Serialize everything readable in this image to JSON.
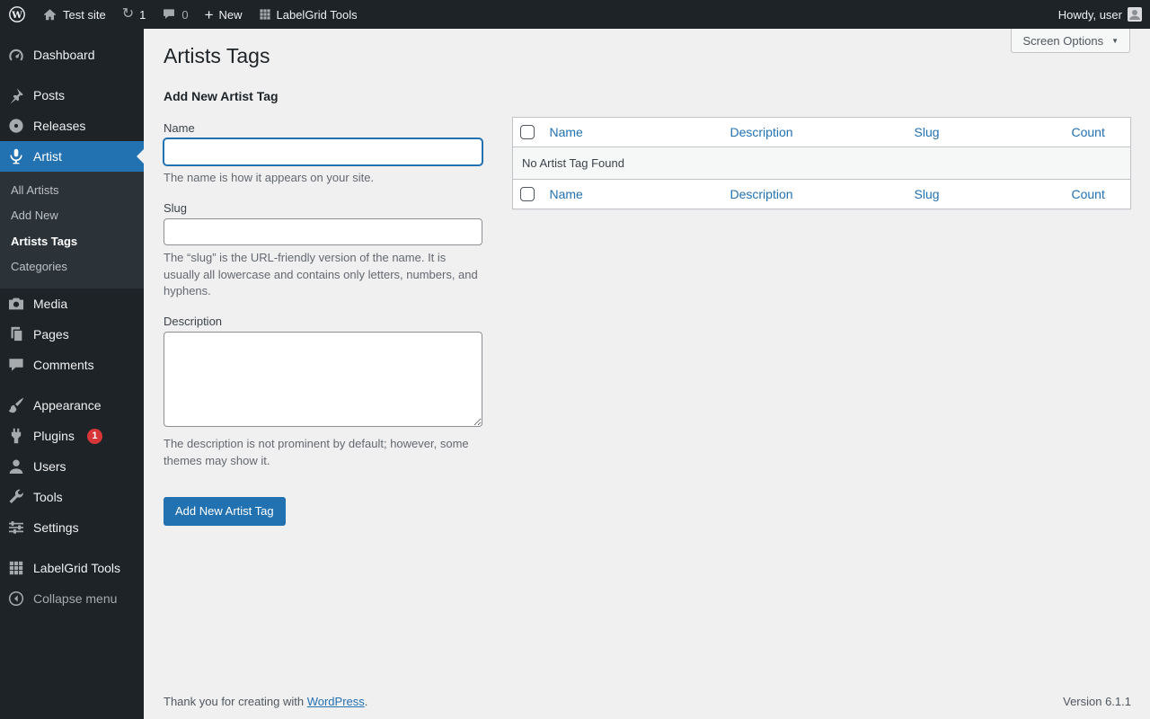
{
  "colors": {
    "accent": "#2271b1",
    "admin_dark": "#1d2327",
    "badge_red": "#d63638",
    "content_bg": "#f0f0f1"
  },
  "admin_bar": {
    "site_name": "Test site",
    "update_count": "1",
    "comment_count": "0",
    "new_label": "New",
    "labelgrid_label": "LabelGrid Tools",
    "howdy_text": "Howdy, user"
  },
  "sidebar": {
    "items": [
      {
        "label": "Dashboard",
        "icon": "dashboard-icon"
      },
      {
        "label": "Posts",
        "icon": "pushpin-icon"
      },
      {
        "label": "Releases",
        "icon": "record-icon"
      },
      {
        "label": "Artist",
        "icon": "microphone-icon",
        "active": true
      },
      {
        "label": "Media",
        "icon": "camera-icon"
      },
      {
        "label": "Pages",
        "icon": "pages-icon"
      },
      {
        "label": "Comments",
        "icon": "comment-bubble-icon"
      },
      {
        "label": "Appearance",
        "icon": "brush-icon"
      },
      {
        "label": "Plugins",
        "icon": "plug-icon",
        "badge": "1"
      },
      {
        "label": "Users",
        "icon": "user-icon"
      },
      {
        "label": "Tools",
        "icon": "wrench-icon"
      },
      {
        "label": "Settings",
        "icon": "sliders-icon"
      },
      {
        "label": "LabelGrid Tools",
        "icon": "grid-icon"
      }
    ],
    "artist_submenu": [
      {
        "label": "All Artists"
      },
      {
        "label": "Add New"
      },
      {
        "label": "Artists Tags",
        "current": true
      },
      {
        "label": "Categories"
      }
    ],
    "collapse_label": "Collapse menu"
  },
  "page": {
    "title": "Artists Tags",
    "screen_options_label": "Screen Options"
  },
  "form": {
    "heading": "Add New Artist Tag",
    "name_label": "Name",
    "name_value": "",
    "name_help": "The name is how it appears on your site.",
    "slug_label": "Slug",
    "slug_value": "",
    "slug_help": "The “slug” is the URL-friendly version of the name. It is usually all lowercase and contains only letters, numbers, and hyphens.",
    "description_label": "Description",
    "description_value": "",
    "description_help": "The description is not prominent by default; however, some themes may show it.",
    "submit_label": "Add New Artist Tag"
  },
  "table": {
    "columns": [
      "Name",
      "Description",
      "Slug",
      "Count"
    ],
    "empty_message": "No Artist Tag Found"
  },
  "footer": {
    "thanks_prefix": "Thank you for creating with ",
    "wordpress_link": "WordPress",
    "thanks_suffix": ".",
    "version": "Version 6.1.1"
  }
}
